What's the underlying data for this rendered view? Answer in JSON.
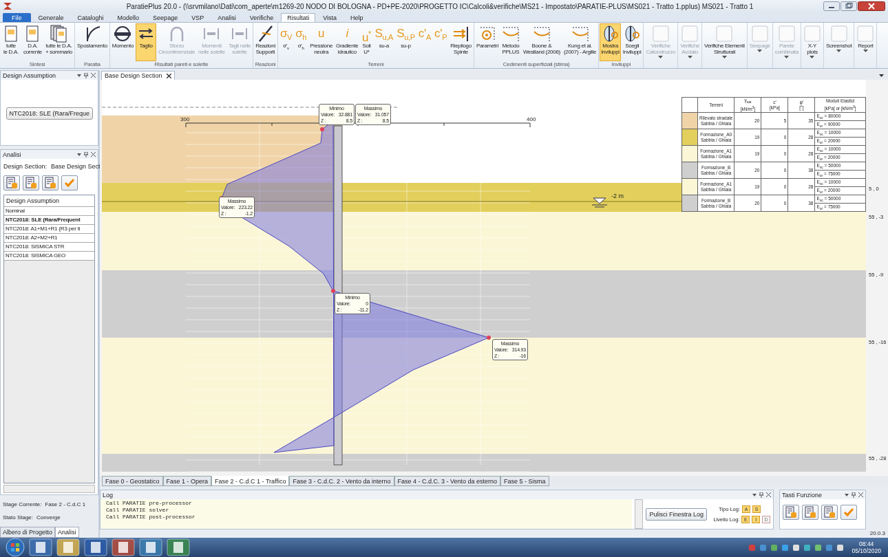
{
  "window": {
    "title": "ParatiePlus 20.0 - (\\\\srvmilano\\Dati\\com_aperte\\m1269-20  NODO DI BOLOGNA - PD+PE-2020\\PROGETTO IC\\Calcoli&verifiche\\MS21 - Impostato\\PARATIE-PLUS\\MS021 - Tratto 1.pplus) MS021 - Tratto 1"
  },
  "ribbon_tabs": [
    {
      "label": "File",
      "selected": false,
      "kind": "file"
    },
    {
      "label": "Generale",
      "selected": false,
      "kind": "tab"
    },
    {
      "label": "Cataloghi",
      "selected": false,
      "kind": "tab"
    },
    {
      "label": "Modello",
      "selected": false,
      "kind": "tab"
    },
    {
      "label": "Seepage",
      "selected": false,
      "kind": "tab"
    },
    {
      "label": "VSP",
      "selected": false,
      "kind": "tab"
    },
    {
      "label": "Analisi",
      "selected": false,
      "kind": "tab"
    },
    {
      "label": "Verifiche",
      "selected": false,
      "kind": "tab"
    },
    {
      "label": "Risultati",
      "selected": true,
      "kind": "tab"
    },
    {
      "label": "Vista",
      "selected": false,
      "kind": "tab"
    },
    {
      "label": "Help",
      "selected": false,
      "kind": "tab"
    }
  ],
  "ribbon_groups": [
    {
      "label": "Sintesi",
      "buttons": [
        {
          "label": "tutte\nle D.A.",
          "kind": "sheet",
          "selected": false,
          "disabled": false,
          "dropdown": false
        },
        {
          "label": "D.A.\ncorrente",
          "kind": "sheet",
          "selected": false,
          "disabled": false,
          "dropdown": false
        },
        {
          "label": "tutte le D.A.\n+ sommario",
          "kind": "sheets",
          "selected": false,
          "disabled": false,
          "dropdown": false
        }
      ]
    },
    {
      "label": "Paratia",
      "buttons": [
        {
          "label": "Spostamento",
          "kind": "curve",
          "selected": false,
          "disabled": false,
          "dropdown": false
        }
      ]
    },
    {
      "label": "Risultati pareti e solette",
      "buttons": [
        {
          "label": "Momento",
          "kind": "beam",
          "selected": false,
          "disabled": false,
          "dropdown": false
        },
        {
          "label": "Taglio",
          "kind": "arrows",
          "selected": true,
          "disabled": false,
          "dropdown": false
        },
        {
          "label": "Sforzo\nCirconferenziale",
          "kind": "arc",
          "selected": false,
          "disabled": true,
          "dropdown": false
        },
        {
          "label": "Momenti\nnelle solette",
          "kind": "slab",
          "selected": false,
          "disabled": true,
          "dropdown": false
        },
        {
          "label": "Tagli nelle\nsolette",
          "kind": "slab",
          "selected": false,
          "disabled": true,
          "dropdown": false
        }
      ]
    },
    {
      "label": "Reazioni",
      "buttons": [
        {
          "label": "Reazioni\nSupporti",
          "kind": "support",
          "selected": false,
          "disabled": false,
          "dropdown": false
        }
      ]
    },
    {
      "label": "Terreni",
      "buttons": [
        {
          "label": "σ'$_{v}$",
          "glyph": "σ$_{V}$",
          "kind": "glyph",
          "selected": false,
          "disabled": false,
          "dropdown": false
        },
        {
          "label": "σ'$_{h}$",
          "glyph": "σ$_{h}$",
          "kind": "glyph",
          "selected": false,
          "disabled": false,
          "dropdown": false
        },
        {
          "label": "Pressione\nneutra",
          "glyph": "u",
          "kind": "glyph",
          "selected": false,
          "disabled": false,
          "dropdown": false
        },
        {
          "label": "Gradiente\nidraulico",
          "glyph": "*i*",
          "kind": "glyph",
          "selected": false,
          "disabled": false,
          "dropdown": false
        },
        {
          "label": "Soil\nU*",
          "glyph": "u$^{*}$",
          "kind": "glyph",
          "selected": false,
          "disabled": false,
          "dropdown": false
        },
        {
          "label": "su-a",
          "glyph": "S$_{u,A}$",
          "kind": "glyph",
          "selected": false,
          "disabled": false,
          "dropdown": false
        },
        {
          "label": "su-p",
          "glyph": "S$_{u,P}$",
          "kind": "glyph",
          "selected": false,
          "disabled": false,
          "dropdown": false
        },
        {
          "glyph": "c'$_{A}$",
          "kind": "glyph",
          "selected": false,
          "disabled": false,
          "dropdown": false
        },
        {
          "glyph": "c'$_{P}$",
          "kind": "glyph",
          "selected": false,
          "disabled": false,
          "dropdown": false
        },
        {
          "label": "Riepilogo\nSpinte",
          "kind": "push",
          "selected": false,
          "disabled": false,
          "dropdown": false
        }
      ]
    },
    {
      "label": "Cedimenti superficiali (stima)",
      "buttons": [
        {
          "label": "Parametri",
          "kind": "target",
          "selected": false,
          "disabled": false,
          "dropdown": false
        },
        {
          "label": "Metodo\nPPLUS",
          "kind": "settle",
          "selected": false,
          "disabled": false,
          "dropdown": false
        },
        {
          "label": "Boone &\nWestland (2006)",
          "kind": "settle",
          "selected": false,
          "disabled": false,
          "dropdown": false
        },
        {
          "label": "Kung et al.\n(2007) - Argille",
          "kind": "settle",
          "selected": false,
          "disabled": false,
          "dropdown": false
        }
      ]
    },
    {
      "label": "Inviluppi",
      "buttons": [
        {
          "label": "Mostra\nInviluppi",
          "kind": "envelope",
          "selected": true,
          "disabled": false,
          "dropdown": false
        },
        {
          "label": "Scegli\nInviluppi",
          "kind": "envelope",
          "selected": false,
          "disabled": false,
          "dropdown": false
        }
      ]
    },
    {
      "buttons": [
        {
          "label": "Verifiche\nCalcestruzzo",
          "kind": "blank",
          "selected": false,
          "disabled": true,
          "dropdown": true
        }
      ]
    },
    {
      "buttons": [
        {
          "label": "Verifiche\nAcciaio",
          "kind": "blank",
          "selected": false,
          "disabled": true,
          "dropdown": true
        }
      ]
    },
    {
      "buttons": [
        {
          "label": "Verifiche Elementi\nStrutturali",
          "kind": "blank",
          "selected": false,
          "disabled": false,
          "dropdown": true
        }
      ]
    },
    {
      "buttons": [
        {
          "label": "Seepage",
          "kind": "blank",
          "selected": false,
          "disabled": true,
          "dropdown": true
        }
      ]
    },
    {
      "buttons": [
        {
          "label": "Parete\ncombinata",
          "kind": "blank",
          "selected": false,
          "disabled": true,
          "dropdown": true
        }
      ]
    },
    {
      "buttons": [
        {
          "label": "X-Y\nplots",
          "kind": "blank",
          "selected": false,
          "disabled": false,
          "dropdown": true
        }
      ]
    },
    {
      "buttons": [
        {
          "label": "Screenshot",
          "kind": "blank",
          "selected": false,
          "disabled": false,
          "dropdown": true
        }
      ]
    },
    {
      "buttons": [
        {
          "label": "Report",
          "kind": "blank",
          "selected": false,
          "disabled": false,
          "dropdown": true
        }
      ]
    }
  ],
  "design_assumption_panel": {
    "title": "Design Assumption",
    "dropdown": "NTC2018: SLE (Rara/Freque"
  },
  "analisi_panel": {
    "title": "Analisi",
    "section_label": "Design Section:",
    "section_value": "Base Design Sect",
    "list_header": "Design Assumption",
    "items": [
      {
        "label": "Nominal",
        "selected": false
      },
      {
        "label": "NTC2018: SLE (Rara/Frequent",
        "selected": true
      },
      {
        "label": "NTC2018: A1+M1+R1 (R3 per ti",
        "selected": false
      },
      {
        "label": "NTC2018: A2+M2+R1",
        "selected": false
      },
      {
        "label": "NTC2018: SISMICA STR",
        "selected": false
      },
      {
        "label": "NTC2018: SISMICA GEO",
        "selected": false
      }
    ]
  },
  "stage_info": [
    {
      "label": "Stage Corrente:",
      "value": "Fase 2 - C.d.C 1"
    },
    {
      "label": "Stato Stage:",
      "value": "Converge"
    }
  ],
  "left_tabs": [
    {
      "label": "Albero di Progetto",
      "selected": false
    },
    {
      "label": "Analisi",
      "selected": true
    }
  ],
  "document_tab": {
    "label": "Base Design Section"
  },
  "canvas": {
    "axis_labels": [
      "300",
      "400"
    ],
    "water_level": "-2 m",
    "tooltips": [
      {
        "title": "Minimo",
        "value_label": "Valore:",
        "value": "32.881",
        "depth_label": "Z :",
        "depth": "8.5"
      },
      {
        "title": "Massimo",
        "value_label": "Valore:",
        "value": "31.057",
        "depth_label": "Z :",
        "depth": "8.5"
      },
      {
        "title": "Massimo",
        "value_label": "Valore:",
        "value": "223.22",
        "depth_label": "Z :",
        "depth": "-1.2"
      },
      {
        "title": "Minimo",
        "value_label": "Valore:",
        "value": "0",
        "depth_label": "Z :",
        "depth": "-11.2"
      },
      {
        "title": "Massimo",
        "value_label": "Valore:",
        "value": "314.93",
        "depth_label": "Z :",
        "depth": "-16"
      }
    ],
    "depth_labels": [
      "5 , 0",
      "55 , -3",
      "55 , -9",
      "55 , -16",
      "55 , -28"
    ]
  },
  "soil_legend": {
    "headers": [
      [
        "Terreni"
      ],
      [
        "γ$_{sat}$",
        "[kN/m$^{3}$]"
      ],
      [
        "c'",
        "[kPa]"
      ],
      [
        "φ'",
        "[°]"
      ],
      [
        "Moduli Elastici",
        "[kPa] or [kN/m$^{3}$]"
      ]
    ],
    "rows": [
      {
        "name": "Rilevato stradale",
        "type": "Sabbia / Ghiaia",
        "gamma": "20",
        "c": "5",
        "phi": "35",
        "evc": "E$_{vc}$ = 80000",
        "eur": "E$_{ur}$ = 90000",
        "color": "#f0d4a8"
      },
      {
        "name": "Formazione_A0",
        "type": "Sabbia / Ghiaia",
        "gamma": "19",
        "c": "0",
        "phi": "28",
        "evc": "E$_{vc}$ = 10000",
        "eur": "E$_{ur}$ = 20000",
        "color": "#e2cf5c"
      },
      {
        "name": "Formazione_A1",
        "type": "Sabbia / Ghiaia",
        "gamma": "19",
        "c": "0",
        "phi": "28",
        "evc": "E$_{vc}$ = 10000",
        "eur": "E$_{ur}$ = 20000",
        "color": "#fbf6d6"
      },
      {
        "name": "Formazione_B",
        "type": "Sabbia / Ghiaia",
        "gamma": "20",
        "c": "0",
        "phi": "38",
        "evc": "E$_{vc}$ = 50000",
        "eur": "E$_{ur}$ = 75000",
        "color": "#cfcfcf"
      },
      {
        "name": "Formazione_A1",
        "type": "Sabbia / Ghiaia",
        "gamma": "19",
        "c": "0",
        "phi": "28",
        "evc": "E$_{vc}$ = 10000",
        "eur": "E$_{ur}$ = 20000",
        "color": "#fbf6d6"
      },
      {
        "name": "Formazione_B",
        "type": "Sabbia / Ghiaia",
        "gamma": "20",
        "c": "0",
        "phi": "38",
        "evc": "E$_{vc}$ = 50000",
        "eur": "E$_{ur}$ = 75000",
        "color": "#cfcfcf"
      }
    ]
  },
  "stage_tabs": [
    {
      "label": "Fase 0 - Geostatico",
      "selected": false
    },
    {
      "label": "Fase 1 - Opera",
      "selected": false
    },
    {
      "label": "Fase 2 - C.d.C 1 - Traffico",
      "selected": true
    },
    {
      "label": "Fase 3 - C.d.C. 2 - Vento da interno",
      "selected": false
    },
    {
      "label": "Fase 4 - C.d.C. 3 - Vento da esterno",
      "selected": false
    },
    {
      "label": "Fase 5 - Sisma",
      "selected": false
    }
  ],
  "log": {
    "title": "Log",
    "lines": [
      "Call PARATIE pre-processor",
      "Call PARATIE solver",
      "Call PARATIE post-processor"
    ],
    "clear_button": "Pulisci Finestra Log",
    "tipo_label": "Tipo Log:",
    "tipo": [
      {
        "label": "A",
        "on": true
      },
      {
        "label": "S",
        "on": true
      }
    ],
    "livello_label": "Livello Log:",
    "livello": [
      {
        "label": "E",
        "on": true
      },
      {
        "label": "I",
        "on": true
      },
      {
        "label": "D",
        "on": false
      }
    ]
  },
  "function_keys": {
    "title": "Tasti Funzione"
  },
  "version": "20.0.3",
  "taskbar": {
    "time": "08:44",
    "date": "05/10/2020"
  }
}
